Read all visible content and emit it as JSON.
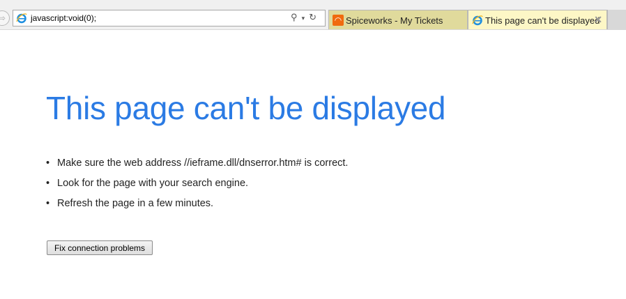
{
  "address_bar": {
    "url": "javascript:void(0);",
    "icon": "ie-icon",
    "controls": [
      "search-icon",
      "dropdown-icon",
      "refresh-icon"
    ]
  },
  "tabs": [
    {
      "label": "Spiceworks - My Tickets",
      "icon": "spiceworks-icon",
      "active": false
    },
    {
      "label": "This page can't be displayed",
      "icon": "ie-icon",
      "active": true
    }
  ],
  "page": {
    "title": "This page can't be displayed",
    "bullet": "•",
    "items": [
      "Make sure the web address //ieframe.dll/dnserror.htm# is correct.",
      "Look for the page with your search engine.",
      "Refresh the page in a few minutes."
    ],
    "button": "Fix connection problems"
  }
}
